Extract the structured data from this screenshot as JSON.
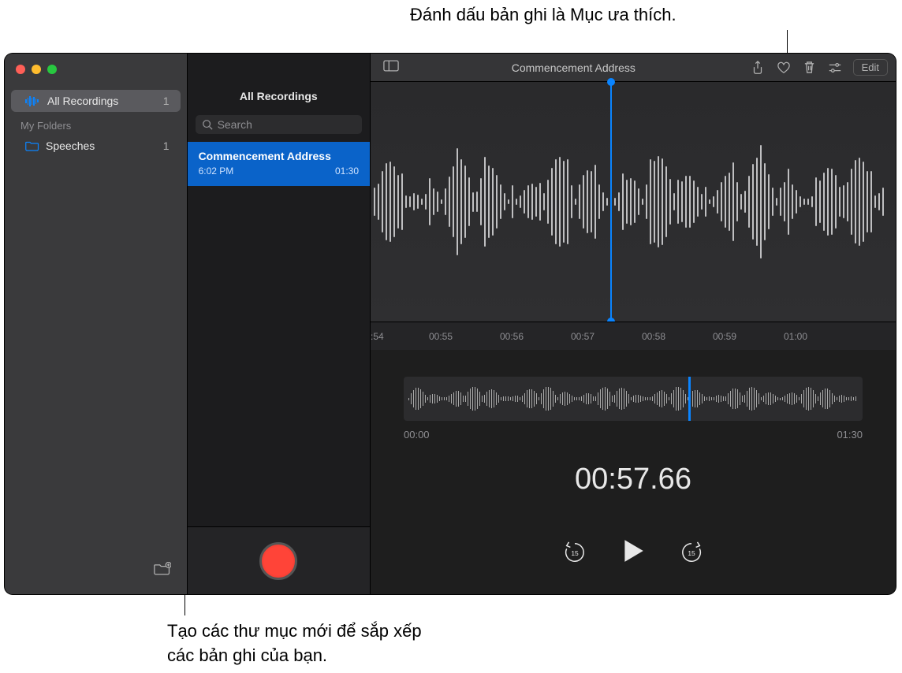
{
  "callouts": {
    "favorite": "Đánh dấu bản ghi là Mục ưa thích.",
    "new_folder": "Tạo các thư mục mới để sắp xếp các bản ghi của bạn."
  },
  "sidebar": {
    "all_recordings": "All Recordings",
    "all_count": "1",
    "section_label": "My Folders",
    "folders": [
      {
        "name": "Speeches",
        "count": "1"
      }
    ]
  },
  "list": {
    "header": "All Recordings",
    "search_placeholder": "Search",
    "items": [
      {
        "title": "Commencement Address",
        "time": "6:02 PM",
        "duration": "01:30"
      }
    ]
  },
  "toolbar": {
    "title": "Commencement Address",
    "edit_label": "Edit"
  },
  "ruler": {
    "ticks": [
      ":54",
      "00:55",
      "00:56",
      "00:57",
      "00:58",
      "00:59",
      "01:00"
    ]
  },
  "overview": {
    "start": "00:00",
    "end": "01:30"
  },
  "playback": {
    "current_time": "00:57.66"
  }
}
